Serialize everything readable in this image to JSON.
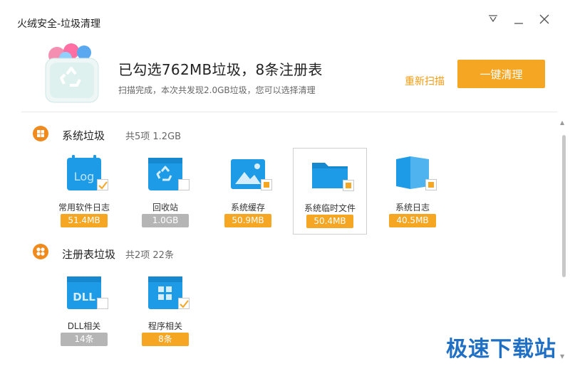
{
  "window": {
    "title": "火绒安全-垃圾清理",
    "buttons": [
      "menu-icon",
      "minimize-icon",
      "close-icon"
    ]
  },
  "summary": {
    "headline": "已勾选762MB垃圾，8条注册表",
    "subtitle": "扫描完成，本次共发现2.0GB垃圾，您可以选择清理",
    "rescan_label": "重新扫描",
    "clean_button_label": "一键清理"
  },
  "colors": {
    "accent": "#f5a623",
    "section_icon": "#f08a1c",
    "tile_blue": "#1e9be6",
    "gray_badge": "#b5b5b5",
    "watermark": "#1f6fc4"
  },
  "sections": [
    {
      "title": "系统垃圾",
      "stat": "共5项 1.2GB",
      "icon": "windows-icon",
      "items": [
        {
          "label": "常用软件日志",
          "value": "51.4MB",
          "icon": "log-file-icon",
          "check": "checked",
          "badge": "orange"
        },
        {
          "label": "回收站",
          "value": "1.0GB",
          "icon": "recycle-bin-icon",
          "check": "unchecked",
          "badge": "gray"
        },
        {
          "label": "系统缓存",
          "value": "50.9MB",
          "icon": "image-cache-icon",
          "check": "partial",
          "badge": "orange"
        },
        {
          "label": "系统临时文件",
          "value": "50.4MB",
          "icon": "folder-icon",
          "check": "partial",
          "badge": "orange"
        },
        {
          "label": "系统日志",
          "value": "40.5MB",
          "icon": "system-log-icon",
          "check": "partial",
          "badge": "orange"
        }
      ]
    },
    {
      "title": "注册表垃圾",
      "stat": "共2项 22条",
      "icon": "registry-icon",
      "items": [
        {
          "label": "DLL相关",
          "value": "14条",
          "icon": "dll-file-icon",
          "check": "unchecked",
          "badge": "gray"
        },
        {
          "label": "程序相关",
          "value": "8条",
          "icon": "program-grid-icon",
          "check": "checked",
          "badge": "orange"
        }
      ]
    }
  ],
  "watermark": "极速下载站"
}
